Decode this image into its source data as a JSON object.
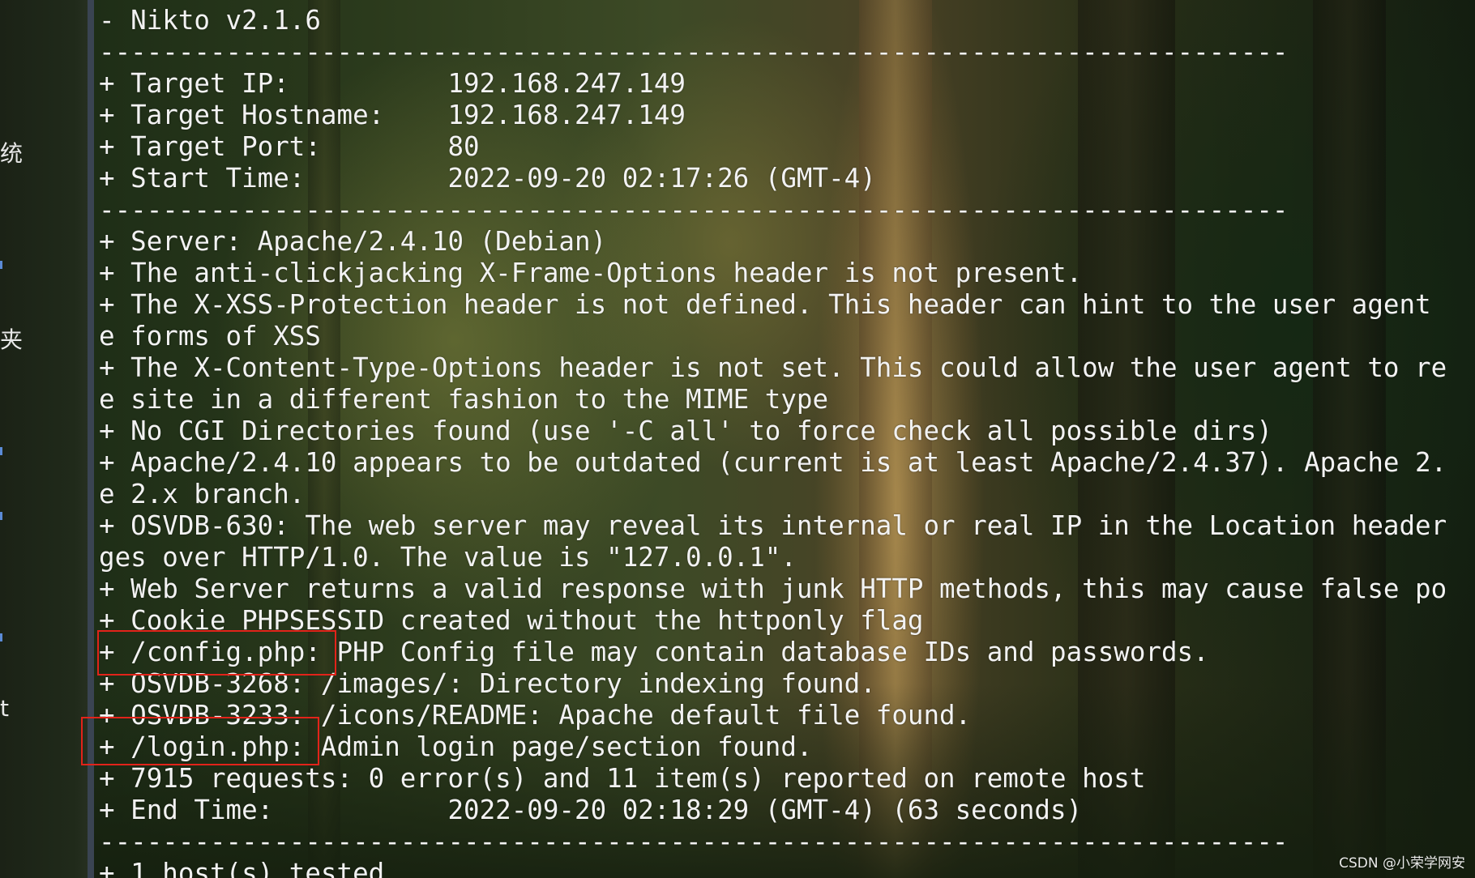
{
  "sidebar": {
    "glyphs": [
      "统",
      "夹",
      "t"
    ]
  },
  "terminal": {
    "lines": [
      "- Nikto v2.1.6",
      "---------------------------------------------------------------------------",
      "+ Target IP:          192.168.247.149",
      "+ Target Hostname:    192.168.247.149",
      "+ Target Port:        80",
      "+ Start Time:         2022-09-20 02:17:26 (GMT-4)",
      "---------------------------------------------------------------------------",
      "+ Server: Apache/2.4.10 (Debian)",
      "+ The anti-clickjacking X-Frame-Options header is not present.",
      "+ The X-XSS-Protection header is not defined. This header can hint to the user agent",
      "e forms of XSS",
      "+ The X-Content-Type-Options header is not set. This could allow the user agent to re",
      "e site in a different fashion to the MIME type",
      "+ No CGI Directories found (use '-C all' to force check all possible dirs)",
      "+ Apache/2.4.10 appears to be outdated (current is at least Apache/2.4.37). Apache 2.",
      "e 2.x branch.",
      "+ OSVDB-630: The web server may reveal its internal or real IP in the Location header",
      "ges over HTTP/1.0. The value is \"127.0.0.1\".",
      "+ Web Server returns a valid response with junk HTTP methods, this may cause false po",
      "+ Cookie PHPSESSID created without the httponly flag",
      "+ /config.php: PHP Config file may contain database IDs and passwords.",
      "+ OSVDB-3268: /images/: Directory indexing found.",
      "+ OSVDB-3233: /icons/README: Apache default file found.",
      "+ /login.php: Admin login page/section found.",
      "+ 7915 requests: 0 error(s) and 11 item(s) reported on remote host",
      "+ End Time:           2022-09-20 02:18:29 (GMT-4) (63 seconds)",
      "---------------------------------------------------------------------------",
      "+ 1 host(s) tested"
    ]
  },
  "highlights": {
    "color": "#e2231a",
    "items": [
      "+ /config.php:",
      "+ /login.php:"
    ]
  },
  "watermark": "CSDN @小荣学网安"
}
